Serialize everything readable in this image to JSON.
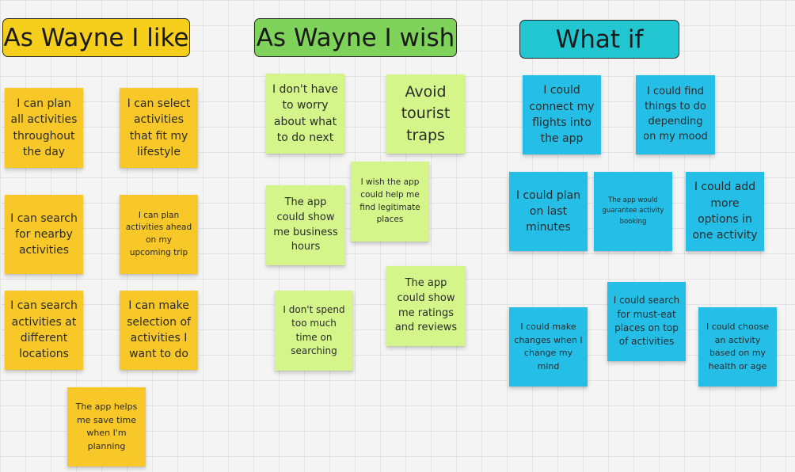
{
  "board": {
    "headers": {
      "like": "As Wayne I like",
      "wish": "As Wayne I wish",
      "whatif": "What if"
    },
    "like_notes": [
      "I can plan all activities throughout the day",
      "I can select activities that fit my lifestyle",
      "I can search for nearby activities",
      "I can plan activities ahead on my upcoming trip",
      "I can search activities at different locations",
      "I can make selection of activities I want to do",
      "The app helps me save time when I'm planning"
    ],
    "wish_notes": [
      "I don't have to worry about what to do next",
      "Avoid tourist traps",
      "I wish the app could help me find legitimate places",
      "The app could show me business hours",
      "The app could show me ratings and reviews",
      "I don't spend too much time on searching"
    ],
    "whatif_notes": [
      "I could connect my flights into the app",
      "I could find things to do depending on my mood",
      "I could plan on last minutes",
      "The app would guarantee activity booking",
      "I could add more options in one activity",
      "I could search for must-eat places on top of activities",
      "I could make changes when I change my mind",
      "I could choose an activity based on my health or age"
    ],
    "colors": {
      "like": "#f8c728",
      "wish": "#d3f58a",
      "whatif": "#25bee6",
      "header_like": "#f6cf1c",
      "header_wish": "#7fd25a",
      "header_whatif": "#21c6d0"
    }
  }
}
